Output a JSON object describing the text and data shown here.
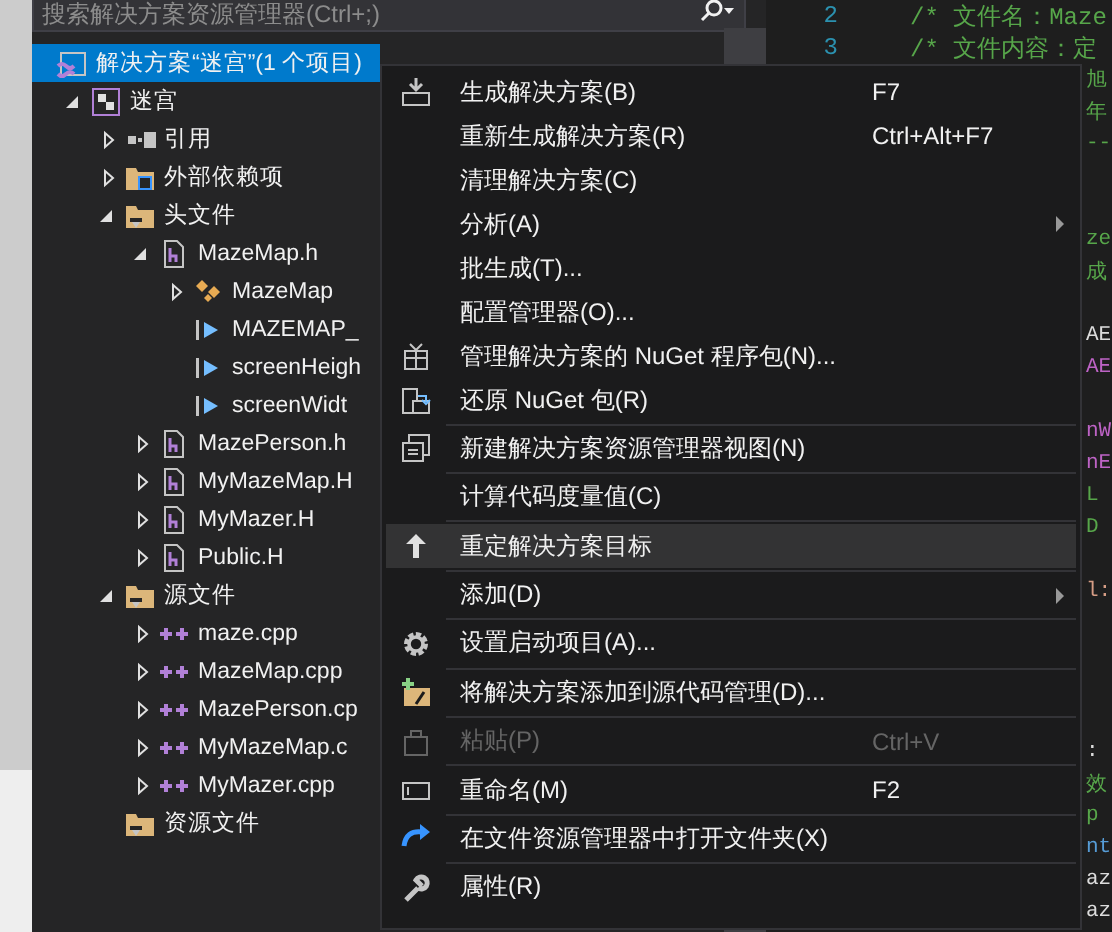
{
  "explorer": {
    "search": {
      "placeholder": "搜索解决方案资源管理器(Ctrl+;)"
    },
    "tree": [
      {
        "label": "解决方案“迷宫”(1 个项目)",
        "kind": "solution",
        "selected": true,
        "children": [
          {
            "label": "迷宫",
            "kind": "project",
            "selected": false,
            "expanded": true,
            "children": [
              {
                "label": "引用",
                "kind": "references",
                "selected": false,
                "expanded": false
              },
              {
                "label": "外部依赖项",
                "kind": "external",
                "selected": false,
                "expanded": false
              },
              {
                "label": "头文件",
                "kind": "filter",
                "selected": false,
                "expanded": true,
                "children": [
                  {
                    "label": "MazeMap.h",
                    "kind": "header",
                    "selected": false,
                    "expanded": true,
                    "children": [
                      {
                        "label": "MazeMap",
                        "kind": "class",
                        "selected": false,
                        "expanded": false
                      },
                      {
                        "label": "MAZEMAP_",
                        "kind": "member",
                        "selected": false
                      },
                      {
                        "label": "screenHeigh",
                        "kind": "member",
                        "selected": false
                      },
                      {
                        "label": "screenWidt",
                        "kind": "member",
                        "selected": false
                      }
                    ]
                  },
                  {
                    "label": "MazePerson.h",
                    "kind": "header",
                    "selected": false,
                    "expanded": false
                  },
                  {
                    "label": "MyMazeMap.H",
                    "kind": "header",
                    "selected": false,
                    "expanded": false
                  },
                  {
                    "label": "MyMazer.H",
                    "kind": "header",
                    "selected": false,
                    "expanded": false
                  },
                  {
                    "label": "Public.H",
                    "kind": "header",
                    "selected": false,
                    "expanded": false
                  }
                ]
              },
              {
                "label": "源文件",
                "kind": "filter",
                "selected": false,
                "expanded": true,
                "children": [
                  {
                    "label": "maze.cpp",
                    "kind": "cpp",
                    "selected": false,
                    "expanded": false
                  },
                  {
                    "label": "MazeMap.cpp",
                    "kind": "cpp",
                    "selected": false,
                    "expanded": false
                  },
                  {
                    "label": "MazePerson.cp",
                    "kind": "cpp",
                    "selected": false,
                    "expanded": false
                  },
                  {
                    "label": "MyMazeMap.c",
                    "kind": "cpp",
                    "selected": false,
                    "expanded": false
                  },
                  {
                    "label": "MyMazer.cpp",
                    "kind": "cpp",
                    "selected": false,
                    "expanded": false
                  }
                ]
              },
              {
                "label": "资源文件",
                "kind": "filter",
                "selected": false
              }
            ]
          }
        ]
      }
    ]
  },
  "editor": {
    "lines": [
      {
        "number": "2",
        "text": "/* 文件名：Maze"
      },
      {
        "number": "3",
        "text": "/* 文件内容：定"
      }
    ],
    "fragments": [
      {
        "kind": "text",
        "text": "旭",
        "color": "#57a64a"
      },
      {
        "kind": "text",
        "text": "年",
        "color": "#57a64a"
      },
      {
        "kind": "text",
        "text": "--",
        "color": "#57a64a"
      },
      {
        "kind": "blank"
      },
      {
        "kind": "blank"
      },
      {
        "kind": "text",
        "text": "ze",
        "color": "#57a64a"
      },
      {
        "kind": "text",
        "text": "成",
        "color": "#57a64a"
      },
      {
        "kind": "blank"
      },
      {
        "kind": "text",
        "text": "AE",
        "color": "#dcdcdc"
      },
      {
        "kind": "text",
        "text": "AE",
        "color": "#bd63c5"
      },
      {
        "kind": "blank"
      },
      {
        "kind": "text",
        "text": "nW",
        "color": "#bd63c5"
      },
      {
        "kind": "text",
        "text": "nE",
        "color": "#bd63c5"
      },
      {
        "kind": "text",
        "text": "L",
        "color": "#57a64a"
      },
      {
        "kind": "text",
        "text": "D",
        "color": "#57a64a"
      },
      {
        "kind": "blank"
      },
      {
        "kind": "text",
        "text": "l:",
        "color": "#d69d85"
      },
      {
        "kind": "blank"
      },
      {
        "kind": "blank"
      },
      {
        "kind": "blank"
      },
      {
        "kind": "blank"
      },
      {
        "kind": "text",
        "text": ":",
        "color": "#dcdcdc"
      },
      {
        "kind": "text",
        "text": "效",
        "color": "#57a64a"
      },
      {
        "kind": "text",
        "text": "p",
        "color": "#57a64a"
      },
      {
        "kind": "text",
        "text": "nt",
        "color": "#569cd6"
      },
      {
        "kind": "text",
        "text": "az",
        "color": "#dcdcdc"
      },
      {
        "kind": "text",
        "text": "az",
        "color": "#dcdcdc"
      }
    ]
  },
  "context_menu": {
    "items": [
      {
        "kind": "item",
        "label": "生成解决方案(B)",
        "shortcut": "F7",
        "selected": false
      },
      {
        "kind": "item",
        "label": "重新生成解决方案(R)",
        "shortcut": "Ctrl+Alt+F7",
        "selected": false
      },
      {
        "kind": "item",
        "label": "清理解决方案(C)",
        "selected": false
      },
      {
        "kind": "item",
        "label": "分析(A)",
        "submenu": true,
        "selected": false
      },
      {
        "kind": "item",
        "label": "批生成(T)...",
        "selected": false
      },
      {
        "kind": "item",
        "label": "配置管理器(O)...",
        "selected": false
      },
      {
        "kind": "item",
        "label": "管理解决方案的 NuGet 程序包(N)...",
        "selected": false
      },
      {
        "kind": "item",
        "label": "还原 NuGet 包(R)",
        "selected": false
      },
      {
        "kind": "separator"
      },
      {
        "kind": "item",
        "label": "新建解决方案资源管理器视图(N)",
        "selected": false
      },
      {
        "kind": "separator"
      },
      {
        "kind": "item",
        "label": "计算代码度量值(C)",
        "selected": false
      },
      {
        "kind": "separator"
      },
      {
        "kind": "item",
        "label": "重定解决方案目标",
        "selected": true
      },
      {
        "kind": "separator"
      },
      {
        "kind": "item",
        "label": "添加(D)",
        "submenu": true,
        "selected": false
      },
      {
        "kind": "separator"
      },
      {
        "kind": "item",
        "label": "设置启动项目(A)...",
        "selected": false
      },
      {
        "kind": "separator"
      },
      {
        "kind": "item",
        "label": "将解决方案添加到源代码管理(D)...",
        "selected": false
      },
      {
        "kind": "separator"
      },
      {
        "kind": "item",
        "label": "粘贴(P)",
        "shortcut": "Ctrl+V",
        "disabled": true,
        "selected": false
      },
      {
        "kind": "separator"
      },
      {
        "kind": "item",
        "label": "重命名(M)",
        "shortcut": "F2",
        "selected": false
      },
      {
        "kind": "separator"
      },
      {
        "kind": "item",
        "label": "在文件资源管理器中打开文件夹(X)",
        "selected": false
      },
      {
        "kind": "separator"
      },
      {
        "kind": "item",
        "label": "属性(R)",
        "selected": false
      }
    ]
  }
}
